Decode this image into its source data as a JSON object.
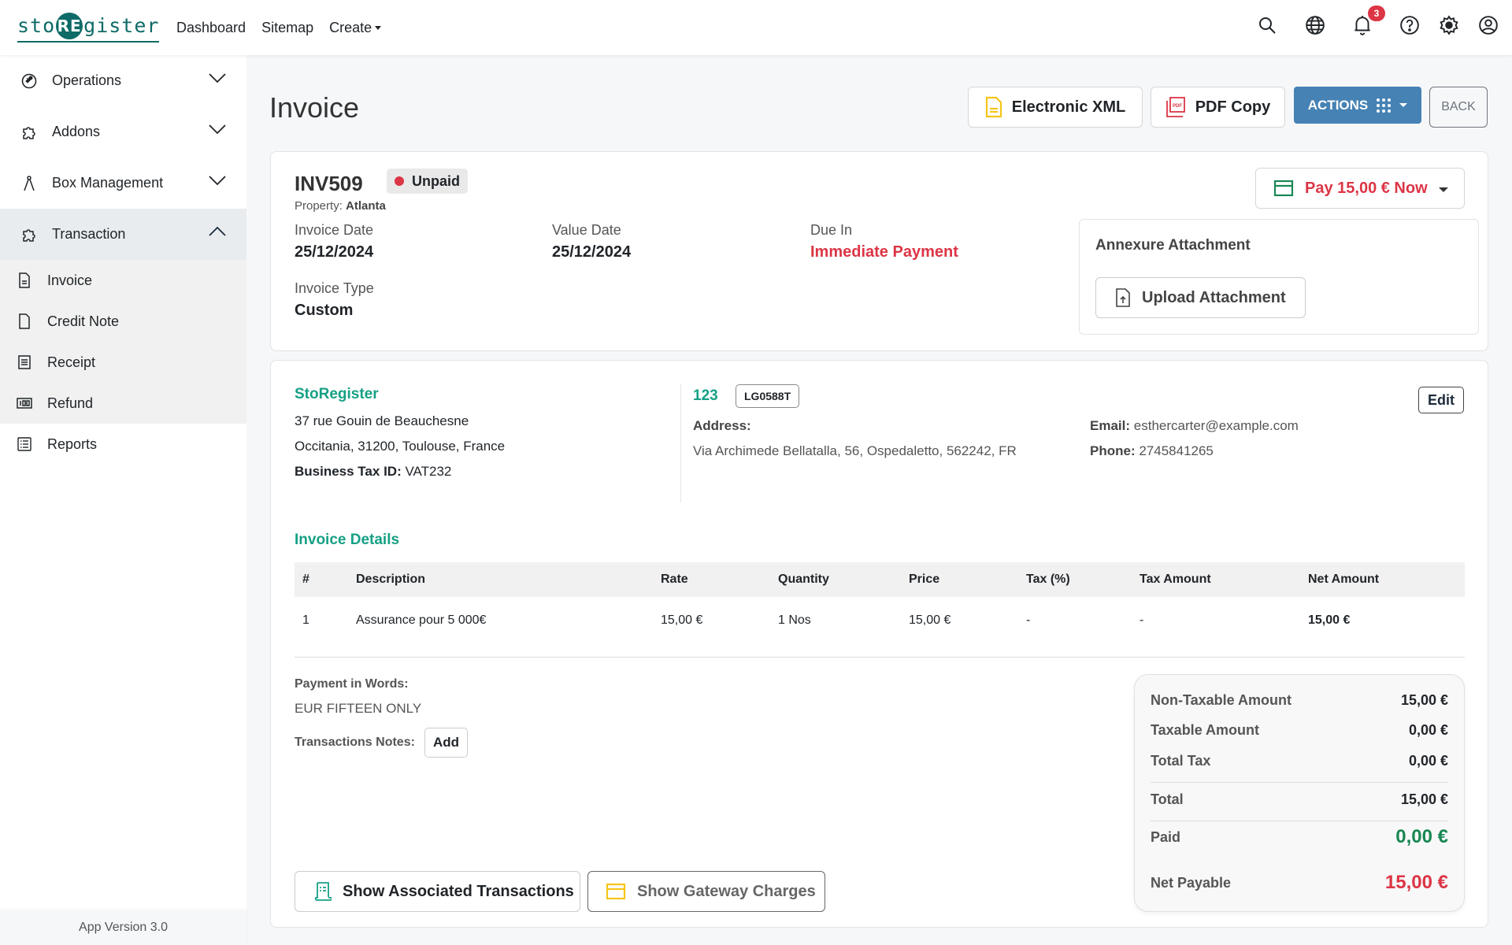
{
  "brand": {
    "logo_pre": "sto",
    "logo_mid": "RE",
    "logo_post": "gister",
    "accent": "#0e6b67"
  },
  "topnav": {
    "items": [
      {
        "label": "Dashboard"
      },
      {
        "label": "Sitemap"
      },
      {
        "label": "Create"
      }
    ]
  },
  "topicons": {
    "notifications_count": "3",
    "icons": [
      "search-icon",
      "globe-icon",
      "bell-icon",
      "help-icon",
      "gear-icon",
      "user-icon"
    ]
  },
  "sidebar": {
    "items": [
      {
        "label": "Operations",
        "icon": "wrench-icon",
        "expanded": false
      },
      {
        "label": "Addons",
        "icon": "puzzle-icon",
        "expanded": false
      },
      {
        "label": "Box Management",
        "icon": "compass-icon",
        "expanded": false
      },
      {
        "label": "Transaction",
        "icon": "puzzle-icon",
        "expanded": true
      }
    ],
    "subitems": [
      {
        "label": "Invoice",
        "icon": "document-icon"
      },
      {
        "label": "Credit Note",
        "icon": "file-icon"
      },
      {
        "label": "Receipt",
        "icon": "receipt-icon"
      },
      {
        "label": "Refund",
        "icon": "cash-icon"
      }
    ],
    "reports": {
      "label": "Reports",
      "icon": "list-icon"
    },
    "app_version": "App Version 3.0"
  },
  "header": {
    "title": "Invoice",
    "electronic_xml": "Electronic XML",
    "pdf_copy": "PDF Copy",
    "actions": "ACTIONS",
    "back": "BACK"
  },
  "invoice": {
    "number": "INV509",
    "status": "Unpaid",
    "property_label": "Property:",
    "property_value": "Atlanta",
    "invoice_date_label": "Invoice Date",
    "invoice_date": "25/12/2024",
    "value_date_label": "Value Date",
    "value_date": "25/12/2024",
    "due_in_label": "Due In",
    "due_in": "Immediate Payment",
    "invoice_type_label": "Invoice Type",
    "invoice_type": "Custom",
    "pay_button": "Pay 15,00 € Now",
    "annexure_title": "Annexure Attachment",
    "upload_button": "Upload Attachment"
  },
  "company": {
    "name": "StoRegister",
    "address1": "37 rue Gouin de Beauchesne",
    "address2": "Occitania, 31200, Toulouse, France",
    "tax_label": "Business Tax ID:",
    "tax_id": "VAT232"
  },
  "customer": {
    "id": "123",
    "tag": "LG0588T",
    "address_label": "Address:",
    "address": "Via Archimede Bellatalla, 56, Ospedaletto, 562242, FR",
    "email_label": "Email:",
    "email": "esthercarter@example.com",
    "phone_label": "Phone:",
    "phone": "2745841265",
    "edit": "Edit"
  },
  "details": {
    "title": "Invoice Details",
    "columns": [
      "#",
      "Description",
      "Rate",
      "Quantity",
      "Price",
      "Tax (%)",
      "Tax Amount",
      "Net Amount"
    ],
    "rows": [
      [
        "1",
        "Assurance pour 5 000€",
        "15,00 €",
        "1 Nos",
        "15,00 €",
        "-",
        "-",
        "15,00 €"
      ]
    ]
  },
  "words": {
    "label": "Payment in Words:",
    "value": "EUR FIFTEEN ONLY",
    "notes_label": "Transactions Notes:",
    "add": "Add"
  },
  "summary": {
    "non_taxable_label": "Non-Taxable Amount",
    "non_taxable": "15,00 €",
    "taxable_label": "Taxable Amount",
    "taxable": "0,00 €",
    "total_tax_label": "Total Tax",
    "total_tax": "0,00 €",
    "total_label": "Total",
    "total": "15,00 €",
    "paid_label": "Paid",
    "paid": "0,00 €",
    "net_payable_label": "Net Payable",
    "net_payable": "15,00 €"
  },
  "footer_buttons": {
    "associated": "Show Associated Transactions",
    "gateway": "Show Gateway Charges"
  },
  "colors": {
    "teal": "#16a085",
    "red": "#dc3545",
    "green": "#198754",
    "blue": "#4682b4",
    "yellow": "#f5c518"
  }
}
